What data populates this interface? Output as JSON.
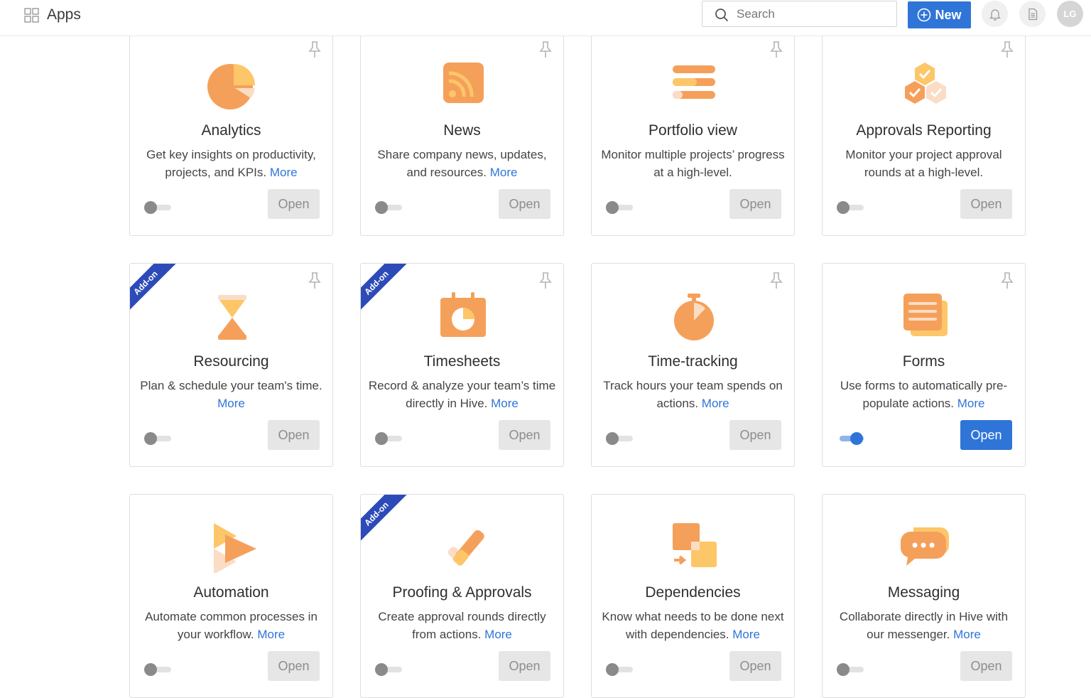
{
  "header": {
    "title": "Apps",
    "search_placeholder": "Search",
    "new_label": "New",
    "avatar_initials": "LG"
  },
  "addon_label": "Add-on",
  "colors": {
    "accent": "#2f75d8",
    "addon_ribbon": "#2d4bb8",
    "icon_orange": "#f5a05a",
    "icon_yellow": "#fdc668",
    "icon_light": "#fbdcc5"
  },
  "cards": [
    {
      "title": "Analytics",
      "desc": "Get key insights on productivity, projects, and KPIs.",
      "more": "More",
      "open": "Open",
      "enabled": false,
      "addon": false,
      "icon": "pie-chart-icon"
    },
    {
      "title": "News",
      "desc": "Share company news, updates, and resources.",
      "more": "More",
      "open": "Open",
      "enabled": false,
      "addon": false,
      "icon": "rss-feed-icon"
    },
    {
      "title": "Portfolio view",
      "desc": "Monitor multiple projects’ progress at a high-level.",
      "more": "",
      "open": "Open",
      "enabled": false,
      "addon": false,
      "icon": "portfolio-bars-icon"
    },
    {
      "title": "Approvals Reporting",
      "desc": "Monitor your project approval rounds at a high-level.",
      "more": "",
      "open": "Open",
      "enabled": false,
      "addon": false,
      "icon": "approval-hexagons-icon"
    },
    {
      "title": "Resourcing",
      "desc": "Plan & schedule your team's time.",
      "more": "More",
      "open": "Open",
      "enabled": false,
      "addon": true,
      "icon": "hourglass-icon"
    },
    {
      "title": "Timesheets",
      "desc": "Record & analyze your team’s time directly in Hive.",
      "more": "More",
      "open": "Open",
      "enabled": false,
      "addon": true,
      "icon": "calendar-clock-icon"
    },
    {
      "title": "Time-tracking",
      "desc": "Track hours your team spends on actions.",
      "more": "More",
      "open": "Open",
      "enabled": false,
      "addon": false,
      "icon": "stopwatch-icon"
    },
    {
      "title": "Forms",
      "desc": "Use forms to automatically pre-populate actions.",
      "more": "More",
      "open": "Open",
      "enabled": true,
      "addon": false,
      "icon": "forms-icon"
    },
    {
      "title": "Automation",
      "desc": "Automate common processes in your workflow.",
      "more": "More",
      "open": "Open",
      "enabled": false,
      "addon": false,
      "icon": "automation-play-icon"
    },
    {
      "title": "Proofing & Approvals",
      "desc": "Create approval rounds directly from actions.",
      "more": "More",
      "open": "Open",
      "enabled": false,
      "addon": true,
      "icon": "checkmark-icon"
    },
    {
      "title": "Dependencies",
      "desc": "Know what needs to be done next with dependencies.",
      "more": "More",
      "open": "Open",
      "enabled": false,
      "addon": false,
      "icon": "dependencies-icon"
    },
    {
      "title": "Messaging",
      "desc": "Collaborate directly in Hive with our messenger.",
      "more": "More",
      "open": "Open",
      "enabled": false,
      "addon": false,
      "icon": "chat-bubbles-icon"
    }
  ]
}
